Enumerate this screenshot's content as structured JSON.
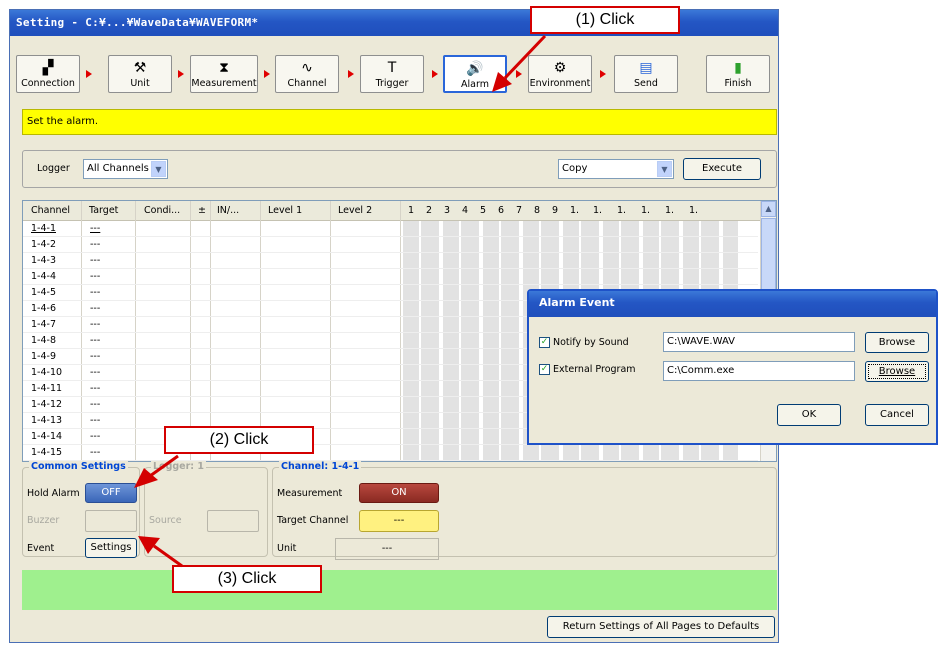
{
  "window": {
    "title": "Setting - C:¥...¥WaveData¥WAVEFORM*"
  },
  "toolbar": {
    "buttons": [
      {
        "label": "Connection",
        "icon": "connection-icon",
        "glyph": "▞"
      },
      {
        "label": "Unit",
        "icon": "unit-icon",
        "glyph": "⚒"
      },
      {
        "label": "Measurement",
        "icon": "hourglass-icon",
        "glyph": "⧗"
      },
      {
        "label": "Channel",
        "icon": "waveform-icon",
        "glyph": "∿"
      },
      {
        "label": "Trigger",
        "icon": "trigger-icon",
        "glyph": "T"
      },
      {
        "label": "Alarm",
        "icon": "speaker-icon",
        "glyph": "🔊"
      },
      {
        "label": "Environment",
        "icon": "tools-icon",
        "glyph": "⚙"
      },
      {
        "label": "Send",
        "icon": "send-icon",
        "glyph": "▤"
      },
      {
        "label": "Finish",
        "icon": "door-icon",
        "glyph": "▮"
      }
    ]
  },
  "hint": "Set the alarm.",
  "logger_bar": {
    "label": "Logger",
    "select": "All Channels",
    "action_select": "Copy",
    "execute": "Execute"
  },
  "grid": {
    "headers": [
      "Channel",
      "Target",
      "Condi...",
      "±",
      "IN/...",
      "Level 1",
      "Level 2",
      "1",
      "2",
      "3",
      "4",
      "5",
      "6",
      "7",
      "8",
      "9",
      "1.",
      "1.",
      "1.",
      "1.",
      "1.",
      "1."
    ],
    "rows": [
      {
        "channel": "1-4-1",
        "target": "---"
      },
      {
        "channel": "1-4-2",
        "target": "---"
      },
      {
        "channel": "1-4-3",
        "target": "---"
      },
      {
        "channel": "1-4-4",
        "target": "---"
      },
      {
        "channel": "1-4-5",
        "target": "---"
      },
      {
        "channel": "1-4-6",
        "target": "---"
      },
      {
        "channel": "1-4-7",
        "target": "---"
      },
      {
        "channel": "1-4-8",
        "target": "---"
      },
      {
        "channel": "1-4-9",
        "target": "---"
      },
      {
        "channel": "1-4-10",
        "target": "---"
      },
      {
        "channel": "1-4-11",
        "target": "---"
      },
      {
        "channel": "1-4-12",
        "target": "---"
      },
      {
        "channel": "1-4-13",
        "target": "---"
      },
      {
        "channel": "1-4-14",
        "target": "---"
      },
      {
        "channel": "1-4-15",
        "target": "---"
      }
    ]
  },
  "common": {
    "title": "Common Settings",
    "hold_alarm_label": "Hold Alarm",
    "hold_alarm_value": "OFF",
    "buzzer_label": "Buzzer",
    "event_label": "Event",
    "settings_button": "Settings"
  },
  "logger_group": {
    "title": "Logger: 1",
    "source_label": "Source"
  },
  "channel_group": {
    "title": "Channel: 1-4-1",
    "measurement_label": "Measurement",
    "measurement_value": "ON",
    "target_label": "Target Channel",
    "target_value": "---",
    "unit_label": "Unit",
    "unit_value": "---"
  },
  "defaults_button": "Return Settings of All Pages to Defaults",
  "dialog": {
    "title": "Alarm Event",
    "notify_label": "Notify by Sound",
    "notify_checked": true,
    "notify_path": "C:\\WAVE.WAV",
    "external_label": "External Program",
    "external_checked": true,
    "external_path": "C:\\Comm.exe",
    "browse": "Browse",
    "ok": "OK",
    "cancel": "Cancel"
  },
  "callouts": {
    "c1": "(1) Click",
    "c2": "(2) Click",
    "c3": "(3) Click"
  },
  "colors": {
    "accent": "#2a66d9",
    "alarm_red": "#d40000",
    "hint_yellow": "#ffff00",
    "status_green": "#9ff08e"
  }
}
